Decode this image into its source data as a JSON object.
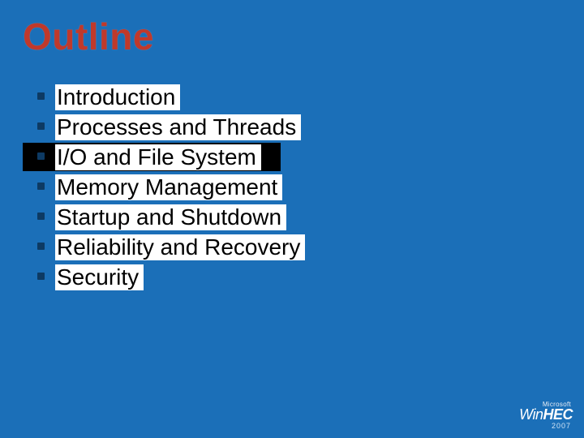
{
  "title": "Outline",
  "bullets": [
    {
      "label": "Introduction",
      "highlighted": false
    },
    {
      "label": "Processes and Threads",
      "highlighted": false
    },
    {
      "label": "I/O and File System",
      "highlighted": true
    },
    {
      "label": "Memory Management",
      "highlighted": false
    },
    {
      "label": "Startup and Shutdown",
      "highlighted": false
    },
    {
      "label": "Reliability and Recovery",
      "highlighted": false
    },
    {
      "label": "Security",
      "highlighted": false
    }
  ],
  "logo": {
    "prefix": "Microsoft",
    "main_a": "Win",
    "main_b": "HEC",
    "year": "2007"
  }
}
